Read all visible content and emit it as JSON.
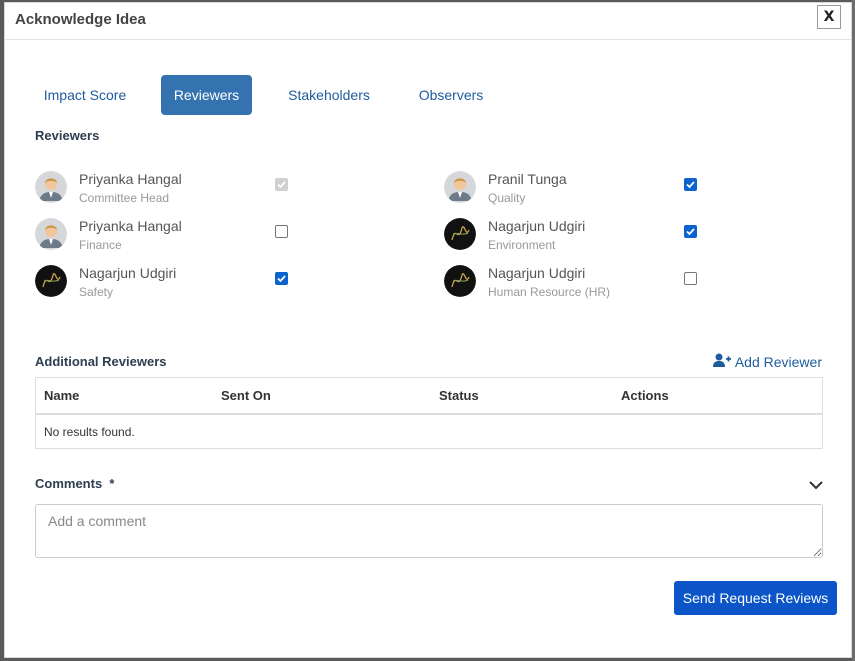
{
  "modal": {
    "title": "Acknowledge Idea",
    "close_label": "X"
  },
  "tabs": [
    {
      "label": "Impact Score",
      "active": false
    },
    {
      "label": "Reviewers",
      "active": true
    },
    {
      "label": "Stakeholders",
      "active": false
    },
    {
      "label": "Observers",
      "active": false
    }
  ],
  "reviewers_section": {
    "title": "Reviewers",
    "items": [
      {
        "name": "Priyanka Hangal",
        "role": "Committee Head",
        "checked": true,
        "disabled": true,
        "avatar": "male-avatar"
      },
      {
        "name": "Pranil Tunga",
        "role": "Quality",
        "checked": true,
        "disabled": false,
        "avatar": "male-avatar"
      },
      {
        "name": "Priyanka Hangal",
        "role": "Finance",
        "checked": false,
        "disabled": false,
        "avatar": "male-avatar"
      },
      {
        "name": "Nagarjun Udgiri",
        "role": "Environment",
        "checked": true,
        "disabled": false,
        "avatar": "signature-avatar"
      },
      {
        "name": "Nagarjun Udgiri",
        "role": "Safety",
        "checked": true,
        "disabled": false,
        "avatar": "signature-avatar"
      },
      {
        "name": "Nagarjun Udgiri",
        "role": "Human Resource (HR)",
        "checked": false,
        "disabled": false,
        "avatar": "signature-avatar"
      }
    ]
  },
  "additional": {
    "title": "Additional Reviewers",
    "add_label": "Add Reviewer",
    "columns": [
      "Name",
      "Sent On",
      "Status",
      "Actions"
    ],
    "empty_text": "No results found."
  },
  "comments": {
    "label": "Comments",
    "required_mark": "*",
    "placeholder": "Add a comment",
    "value": ""
  },
  "footer": {
    "send_label": "Send Request Reviews"
  },
  "colors": {
    "primary": "#0b55c8",
    "tab_active": "#3572b0",
    "link": "#1f5c9e"
  }
}
